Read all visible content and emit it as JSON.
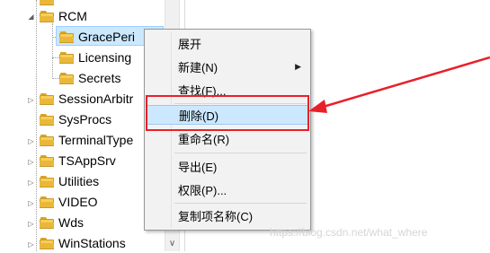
{
  "tree": {
    "items": [
      {
        "label": "RCM",
        "expanded": true
      },
      {
        "label": "GracePeri",
        "selected": true
      },
      {
        "label": "Licensing"
      },
      {
        "label": "Secrets"
      },
      {
        "label": "SessionArbitr"
      },
      {
        "label": "SysProcs"
      },
      {
        "label": "TerminalType"
      },
      {
        "label": "TSAppSrv"
      },
      {
        "label": "Utilities"
      },
      {
        "label": "VIDEO"
      },
      {
        "label": "Wds"
      },
      {
        "label": "WinStations"
      }
    ]
  },
  "context_menu": {
    "items": [
      {
        "label": "展开"
      },
      {
        "label": "新建(N)",
        "submenu": true
      },
      {
        "label": "查找(F)..."
      },
      {
        "label": "删除(D)",
        "highlighted": true
      },
      {
        "label": "重命名(R)"
      },
      {
        "label": "导出(E)"
      },
      {
        "label": "权限(P)..."
      },
      {
        "label": "复制项名称(C)"
      }
    ]
  },
  "annotation": {
    "color": "#e8202a"
  },
  "watermark": "https://blog.csdn.net/what_where"
}
